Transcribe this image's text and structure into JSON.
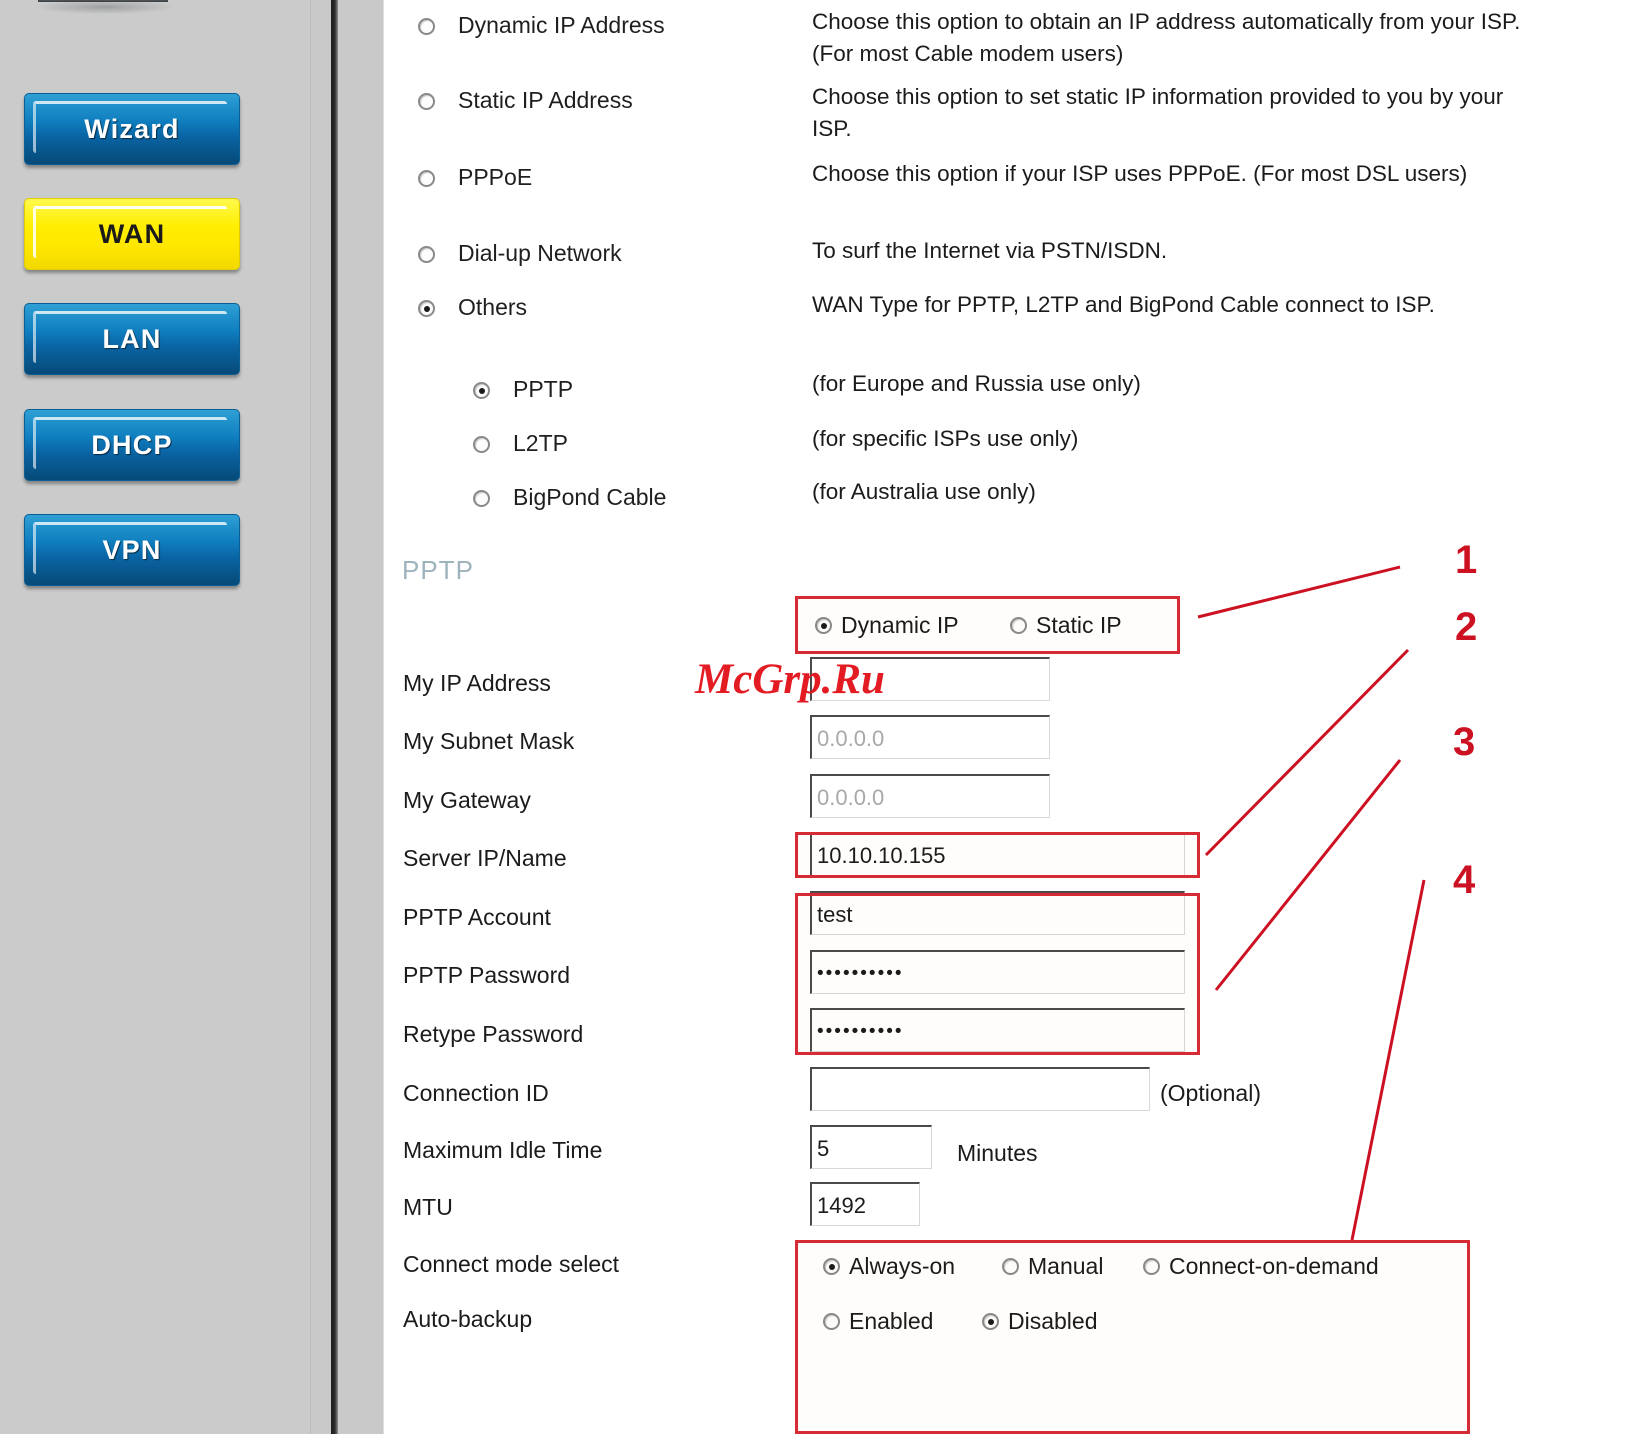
{
  "sidebar": {
    "device_icon": "router-device-image",
    "items": [
      {
        "label": "Wizard",
        "state": "inactive"
      },
      {
        "label": "WAN",
        "state": "active"
      },
      {
        "label": "LAN",
        "state": "inactive"
      },
      {
        "label": "DHCP",
        "state": "inactive"
      },
      {
        "label": "VPN",
        "state": "inactive"
      }
    ]
  },
  "wan_types": [
    {
      "label": "Dynamic IP Address",
      "selected": false,
      "desc": "Choose this option to obtain an IP address automatically from your ISP. (For most Cable modem users)"
    },
    {
      "label": "Static IP Address",
      "selected": false,
      "desc": "Choose this option to set static IP information provided to you by your ISP."
    },
    {
      "label": "PPPoE",
      "selected": false,
      "desc": "Choose this option if your ISP uses PPPoE. (For most DSL users)"
    },
    {
      "label": "Dial-up Network",
      "selected": false,
      "desc": "To surf the Internet via PSTN/ISDN."
    },
    {
      "label": "Others",
      "selected": true,
      "desc": "WAN Type for PPTP, L2TP and BigPond Cable connect to ISP."
    }
  ],
  "others_suboptions": [
    {
      "label": "PPTP",
      "selected": true,
      "desc": "(for Europe and Russia use only)"
    },
    {
      "label": "L2TP",
      "selected": false,
      "desc": "(for specific ISPs use only)"
    },
    {
      "label": "BigPond Cable",
      "selected": false,
      "desc": "(for Australia use only)"
    }
  ],
  "pptp": {
    "heading": "PPTP",
    "ip_mode": {
      "options": [
        {
          "label": "Dynamic IP",
          "selected": true
        },
        {
          "label": "Static IP",
          "selected": false
        }
      ]
    },
    "fields": [
      {
        "label": "My IP Address",
        "value": "",
        "placeholder": ""
      },
      {
        "label": "My Subnet Mask",
        "value": "0.0.0.0",
        "placeholder": "0.0.0.0"
      },
      {
        "label": "My Gateway",
        "value": "0.0.0.0",
        "placeholder": "0.0.0.0"
      },
      {
        "label": "Server IP/Name",
        "value": "10.10.10.155",
        "placeholder": ""
      },
      {
        "label": "PPTP Account",
        "value": "test",
        "placeholder": ""
      },
      {
        "label": "PPTP Password",
        "value": "••••••••••",
        "placeholder": ""
      },
      {
        "label": "Retype Password",
        "value": "••••••••••",
        "placeholder": ""
      },
      {
        "label": "Connection ID",
        "value": "",
        "placeholder": "",
        "suffix": "(Optional)"
      },
      {
        "label": "Maximum Idle Time",
        "value": "5",
        "placeholder": "",
        "suffix": "Minutes"
      },
      {
        "label": "MTU",
        "value": "1492",
        "placeholder": ""
      }
    ],
    "connect_mode": {
      "label": "Connect mode select",
      "options": [
        {
          "label": "Always-on",
          "selected": true
        },
        {
          "label": "Manual",
          "selected": false
        },
        {
          "label": "Connect-on-demand",
          "selected": false
        }
      ]
    },
    "auto_backup": {
      "label": "Auto-backup",
      "options": [
        {
          "label": "Enabled",
          "selected": false
        },
        {
          "label": "Disabled",
          "selected": true
        }
      ]
    }
  },
  "annotations": {
    "numbers": [
      "1",
      "2",
      "3",
      "4"
    ],
    "accent_color": "#cc1122",
    "box_color": "#d62a35"
  },
  "watermark": {
    "text": "McGrp.Ru",
    "color": "#e31b23"
  }
}
